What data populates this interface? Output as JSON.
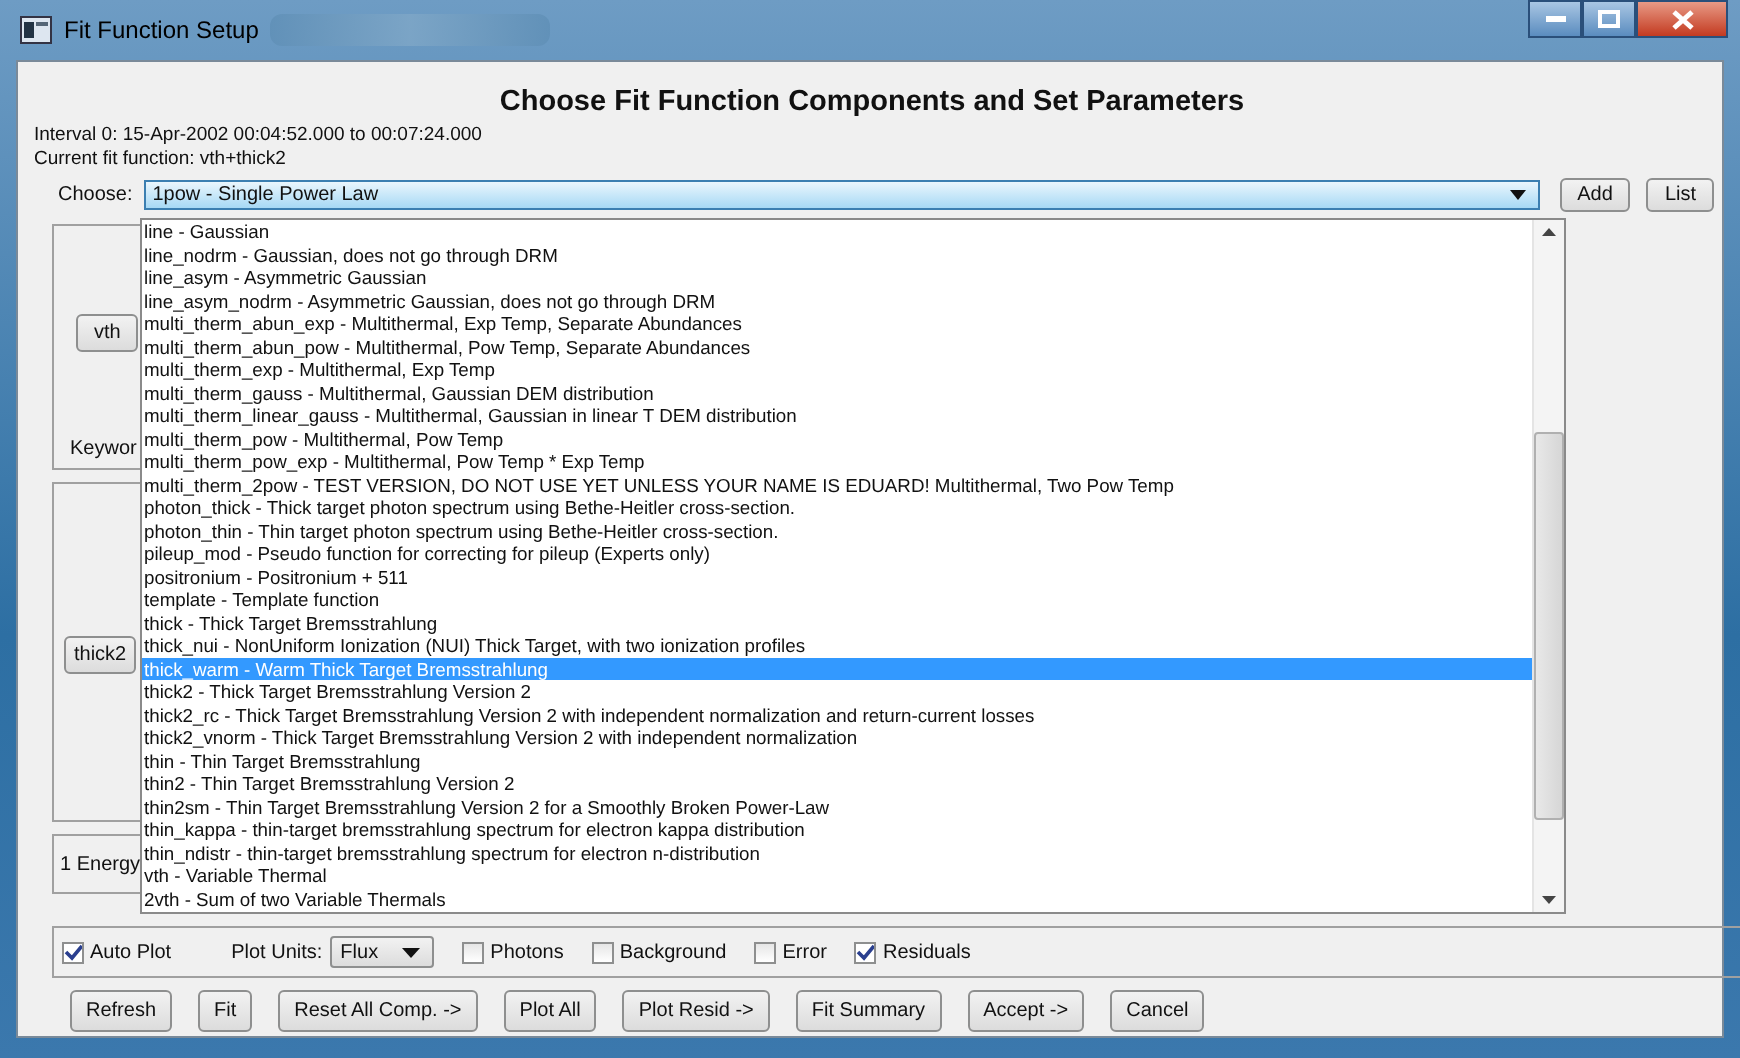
{
  "window": {
    "title": "Fit Function Setup"
  },
  "heading": "Choose Fit Function Components and Set Parameters",
  "interval": "Interval 0:  15-Apr-2002 00:04:52.000 to 00:07:24.000",
  "current_function": "Current fit function: vth+thick2",
  "choose": {
    "label": "Choose:",
    "value": "1pow - Single Power Law"
  },
  "choose_buttons": [
    "Add",
    "List"
  ],
  "behind": {
    "component_buttons": [
      "vth",
      "thick2"
    ],
    "keyword_label": "Keywor",
    "energy_label": "1  Energy"
  },
  "options": [
    {
      "label": "line - Gaussian",
      "selected": false
    },
    {
      "label": "line_nodrm - Gaussian, does not go through DRM",
      "selected": false
    },
    {
      "label": "line_asym - Asymmetric Gaussian",
      "selected": false
    },
    {
      "label": "line_asym_nodrm - Asymmetric Gaussian, does not go through DRM",
      "selected": false
    },
    {
      "label": "multi_therm_abun_exp - Multithermal, Exp Temp, Separate Abundances",
      "selected": false
    },
    {
      "label": "multi_therm_abun_pow - Multithermal, Pow Temp, Separate Abundances",
      "selected": false
    },
    {
      "label": "multi_therm_exp - Multithermal, Exp Temp",
      "selected": false
    },
    {
      "label": "multi_therm_gauss - Multithermal, Gaussian DEM distribution",
      "selected": false
    },
    {
      "label": "multi_therm_linear_gauss - Multithermal, Gaussian in linear T DEM distribution",
      "selected": false
    },
    {
      "label": "multi_therm_pow - Multithermal, Pow Temp",
      "selected": false
    },
    {
      "label": "multi_therm_pow_exp - Multithermal, Pow Temp * Exp Temp",
      "selected": false
    },
    {
      "label": "multi_therm_2pow - TEST VERSION, DO NOT USE YET UNLESS YOUR NAME IS EDUARD!  Multithermal, Two Pow Temp",
      "selected": false
    },
    {
      "label": "photon_thick - Thick target photon spectrum using Bethe-Heitler cross-section.",
      "selected": false
    },
    {
      "label": "photon_thin - Thin target photon spectrum using Bethe-Heitler cross-section.",
      "selected": false
    },
    {
      "label": "pileup_mod - Pseudo function for correcting for pileup (Experts only)",
      "selected": false
    },
    {
      "label": "positronium - Positronium + 511",
      "selected": false
    },
    {
      "label": "template - Template function",
      "selected": false
    },
    {
      "label": "thick - Thick Target Bremsstrahlung",
      "selected": false
    },
    {
      "label": "thick_nui - NonUniform Ionization (NUI) Thick Target, with two ionization profiles",
      "selected": false
    },
    {
      "label": "thick_warm - Warm Thick Target Bremsstrahlung",
      "selected": true
    },
    {
      "label": "thick2 - Thick Target Bremsstrahlung Version 2",
      "selected": false
    },
    {
      "label": "thick2_rc - Thick Target Bremsstrahlung Version 2 with independent normalization and return-current losses",
      "selected": false
    },
    {
      "label": "thick2_vnorm - Thick Target Bremsstrahlung Version 2 with independent normalization",
      "selected": false
    },
    {
      "label": "thin - Thin Target Bremsstrahlung",
      "selected": false
    },
    {
      "label": "thin2 - Thin Target Bremsstrahlung Version 2",
      "selected": false
    },
    {
      "label": "thin2sm - Thin Target Bremsstrahlung Version 2 for a Smoothly Broken Power-Law",
      "selected": false
    },
    {
      "label": "thin_kappa - thin-target bremsstrahlung spectrum for electron kappa distribution",
      "selected": false
    },
    {
      "label": "thin_ndistr - thin-target bremsstrahlung spectrum for electron n-distribution",
      "selected": false
    },
    {
      "label": "vth - Variable Thermal",
      "selected": false
    },
    {
      "label": "2vth - Sum of two Variable Thermals",
      "selected": false
    }
  ],
  "plot_options": {
    "auto_plot": {
      "label": "Auto Plot",
      "checked": true
    },
    "units_label": "Plot Units:",
    "units_value": "Flux",
    "checkboxes": [
      {
        "label": "Photons",
        "checked": false
      },
      {
        "label": "Background",
        "checked": false
      },
      {
        "label": "Error",
        "checked": false
      },
      {
        "label": "Residuals",
        "checked": true
      }
    ]
  },
  "buttons": [
    "Refresh",
    "Fit",
    "Reset All Comp. ->",
    "Plot All",
    "Plot Resid ->",
    "Fit Summary",
    "Accept ->",
    "Cancel"
  ]
}
